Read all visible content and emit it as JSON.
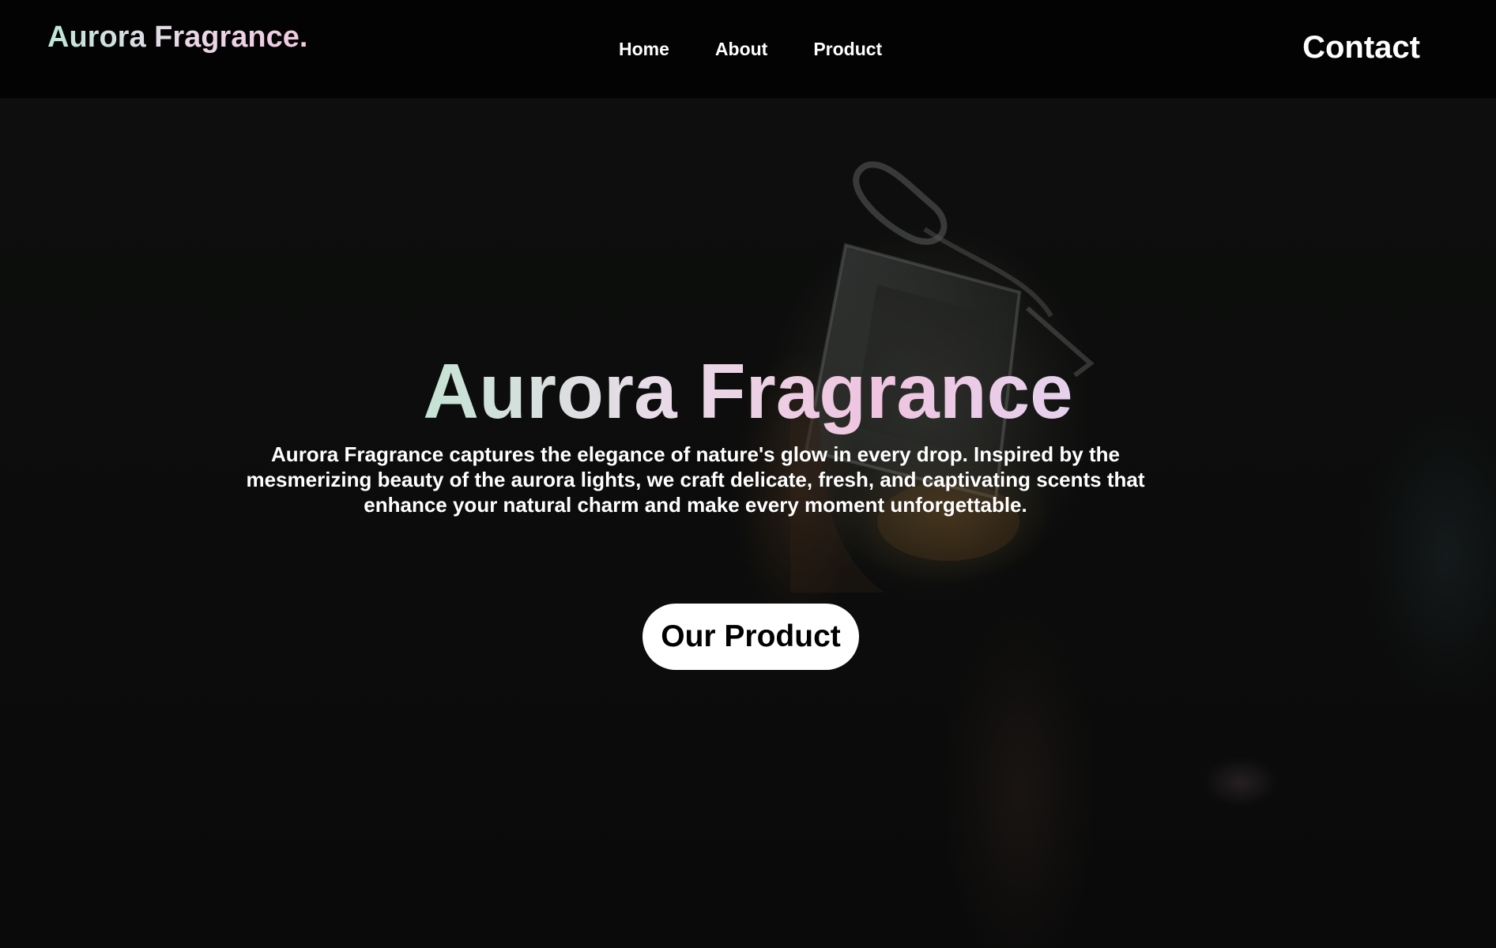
{
  "brand": {
    "logo_text": "Aurora Fragrance."
  },
  "nav": {
    "items": [
      {
        "label": "Home"
      },
      {
        "label": "About"
      },
      {
        "label": "Product"
      }
    ],
    "contact_label": "Contact"
  },
  "hero": {
    "title": "Aurora Fragrance",
    "description": "Aurora Fragrance captures the elegance of nature's glow in every drop. Inspired by the mesmerizing beauty of the aurora lights, we craft delicate, fresh, and captivating scents that enhance your natural charm and make every moment unforgettable.",
    "cta_label": "Our Product",
    "background_image": "perfume-bottle-photo"
  },
  "colors": {
    "background": "#0c0d0c",
    "navbar": "#030303",
    "text": "#ffffff",
    "gradient_mint": "#c5e3d4",
    "gradient_pink": "#f0c4e0",
    "button_bg": "#ffffff",
    "button_text": "#000000"
  }
}
